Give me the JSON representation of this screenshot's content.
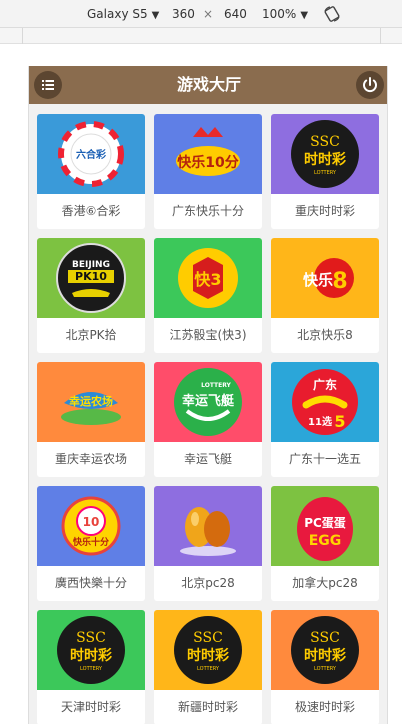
{
  "devtools": {
    "device": "Galaxy S5",
    "width": "360",
    "times": "×",
    "height": "640",
    "zoom": "100%"
  },
  "app": {
    "title": "游戏大厅"
  },
  "colors": {
    "header": "#8a6c4e",
    "header_button": "#5c4631",
    "blue": "#3a9ad9",
    "purple": "#8e6ee0",
    "green": "#3cc85a",
    "orange": "#ff8a3d",
    "red": "#ff4d6a",
    "teal": "#2ba6d9",
    "yellow": "#ffb619",
    "periwinkle": "#5f7fe6",
    "lime": "#7dc241",
    "royal": "#3a8ee8"
  },
  "games": [
    {
      "label": "香港⑥合彩",
      "icon": "six-lottery-icon",
      "bg": "#3a9ad9"
    },
    {
      "label": "广东快乐十分",
      "icon": "happy-ten-icon",
      "bg": "#5f7fe6"
    },
    {
      "label": "重庆时时彩",
      "icon": "ssc-icon",
      "bg": "#8e6ee0"
    },
    {
      "label": "北京PK拾",
      "icon": "pk10-icon",
      "bg": "#7dc241"
    },
    {
      "label": "江苏骰宝(快3)",
      "icon": "dice-icon",
      "bg": "#3cc85a"
    },
    {
      "label": "北京快乐8",
      "icon": "happy-eight-icon",
      "bg": "#ffb619"
    },
    {
      "label": "重庆幸运农场",
      "icon": "lucky-farm-icon",
      "bg": "#ff8a3d"
    },
    {
      "label": "幸运飞艇",
      "icon": "lucky-boat-icon",
      "bg": "#ff4d6a"
    },
    {
      "label": "广东十一选五",
      "icon": "eleven-five-icon",
      "bg": "#2ba6d9"
    },
    {
      "label": "廣西快樂十分",
      "icon": "guangxi-happy-ten-icon",
      "bg": "#5f7fe6"
    },
    {
      "label": "北京pc28",
      "icon": "eggs-icon",
      "bg": "#8e6ee0"
    },
    {
      "label": "加拿大pc28",
      "icon": "pc-egg-icon",
      "bg": "#7dc241"
    },
    {
      "label": "天津时时彩",
      "icon": "ssc-icon",
      "bg": "#3cc85a"
    },
    {
      "label": "新疆时时彩",
      "icon": "ssc-icon",
      "bg": "#ffb619"
    },
    {
      "label": "极速时时彩",
      "icon": "ssc-icon",
      "bg": "#ff8a3d"
    }
  ]
}
